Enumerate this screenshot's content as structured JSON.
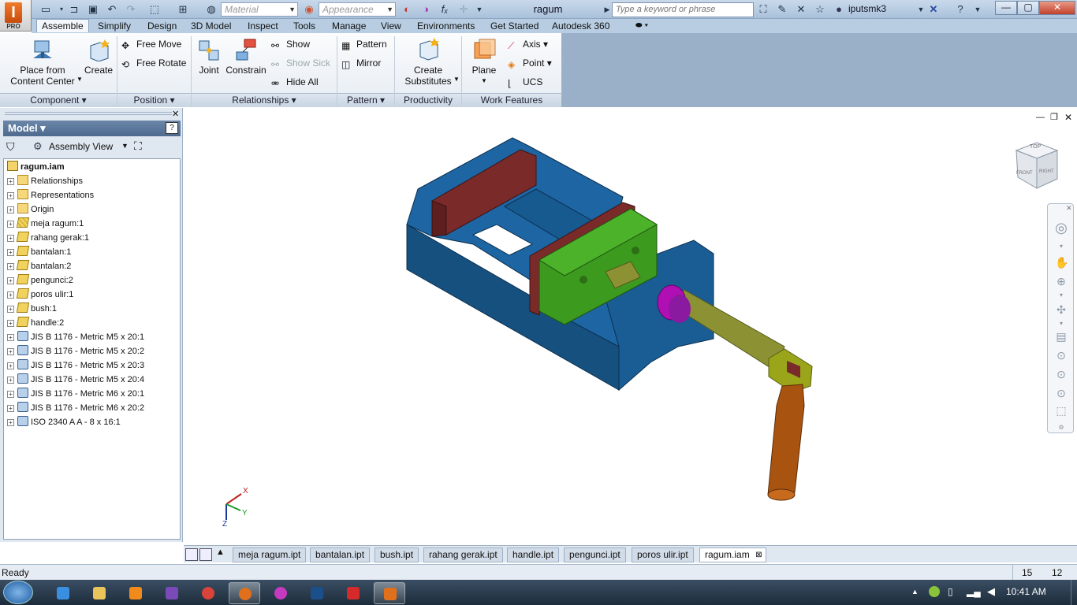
{
  "titlebar": {
    "doc_title": "ragum",
    "material_placeholder": "Material",
    "appearance_placeholder": "Appearance",
    "search_placeholder": "Type a keyword or phrase",
    "user": "iputsmk3",
    "app_logo": "I",
    "app_edition": "PRO"
  },
  "menu_tabs": [
    "Assemble",
    "Simplify",
    "Design",
    "3D Model",
    "Inspect",
    "Tools",
    "Manage",
    "View",
    "Environments",
    "Get Started",
    "Autodesk 360"
  ],
  "ribbon": {
    "component": {
      "label": "Component",
      "place_line1": "Place from",
      "place_line2": "Content Center",
      "create": "Create"
    },
    "position": {
      "label": "Position",
      "free_move": "Free Move",
      "free_rotate": "Free Rotate"
    },
    "relationships": {
      "label": "Relationships",
      "joint": "Joint",
      "constrain": "Constrain",
      "show": "Show",
      "show_sick": "Show Sick",
      "hide_all": "Hide All"
    },
    "pattern": {
      "label": "Pattern",
      "pattern": "Pattern",
      "mirror": "Mirror"
    },
    "productivity": {
      "label": "Productivity",
      "create_line1": "Create",
      "create_line2": "Substitutes"
    },
    "work_features": {
      "label": "Work Features",
      "plane": "Plane",
      "axis": "Axis",
      "point": "Point",
      "ucs": "UCS"
    }
  },
  "browser": {
    "title": "Model",
    "view": "Assembly View",
    "root": "ragum.iam",
    "nodes": [
      {
        "label": "Relationships",
        "icon": "folder"
      },
      {
        "label": "Representations",
        "icon": "representations"
      },
      {
        "label": "Origin",
        "icon": "folder"
      },
      {
        "label": "meja ragum:1",
        "icon": "grounded-part"
      },
      {
        "label": "rahang gerak:1",
        "icon": "part"
      },
      {
        "label": "bantalan:1",
        "icon": "part"
      },
      {
        "label": "bantalan:2",
        "icon": "part"
      },
      {
        "label": "pengunci:2",
        "icon": "part"
      },
      {
        "label": "poros ulir:1",
        "icon": "part"
      },
      {
        "label": "bush:1",
        "icon": "part"
      },
      {
        "label": "handle:2",
        "icon": "part"
      },
      {
        "label": "JIS B 1176 - Metric M5 x 20:1",
        "icon": "bolt"
      },
      {
        "label": "JIS B 1176 - Metric M5 x 20:2",
        "icon": "bolt"
      },
      {
        "label": "JIS B 1176 - Metric M5 x 20:3",
        "icon": "bolt"
      },
      {
        "label": "JIS B 1176 - Metric M5 x 20:4",
        "icon": "bolt"
      },
      {
        "label": "JIS B 1176 - Metric M6 x 20:1",
        "icon": "bolt"
      },
      {
        "label": "JIS B 1176 - Metric M6 x 20:2",
        "icon": "bolt"
      },
      {
        "label": "ISO 2340 A A - 8 x 16:1",
        "icon": "bolt"
      }
    ]
  },
  "viewcube": {
    "face_top": "TOP",
    "face_front": "FRONT",
    "face_right": "RIGHT"
  },
  "triad": {
    "x": "X",
    "y": "Y",
    "z": "Z"
  },
  "doc_tabs": [
    "meja ragum.ipt",
    "bantalan.ipt",
    "bush.ipt",
    "rahang gerak.ipt",
    "handle.ipt",
    "pengunci.ipt",
    "poros ulir.ipt",
    "ragum.iam"
  ],
  "active_doc_tab": "ragum.iam",
  "status": {
    "text": "Ready",
    "count1": "15",
    "count2": "12"
  },
  "taskbar": {
    "time": "10:41 AM"
  },
  "colors": {
    "vise_body": "#1b5e96",
    "jaw_pads": "#7b2a2a",
    "moving_jaw": "#3c9a1f",
    "bush": "#b00fb3",
    "screw": "#8c9233",
    "handle": "#a85410",
    "accent": "#3f6d9a"
  }
}
